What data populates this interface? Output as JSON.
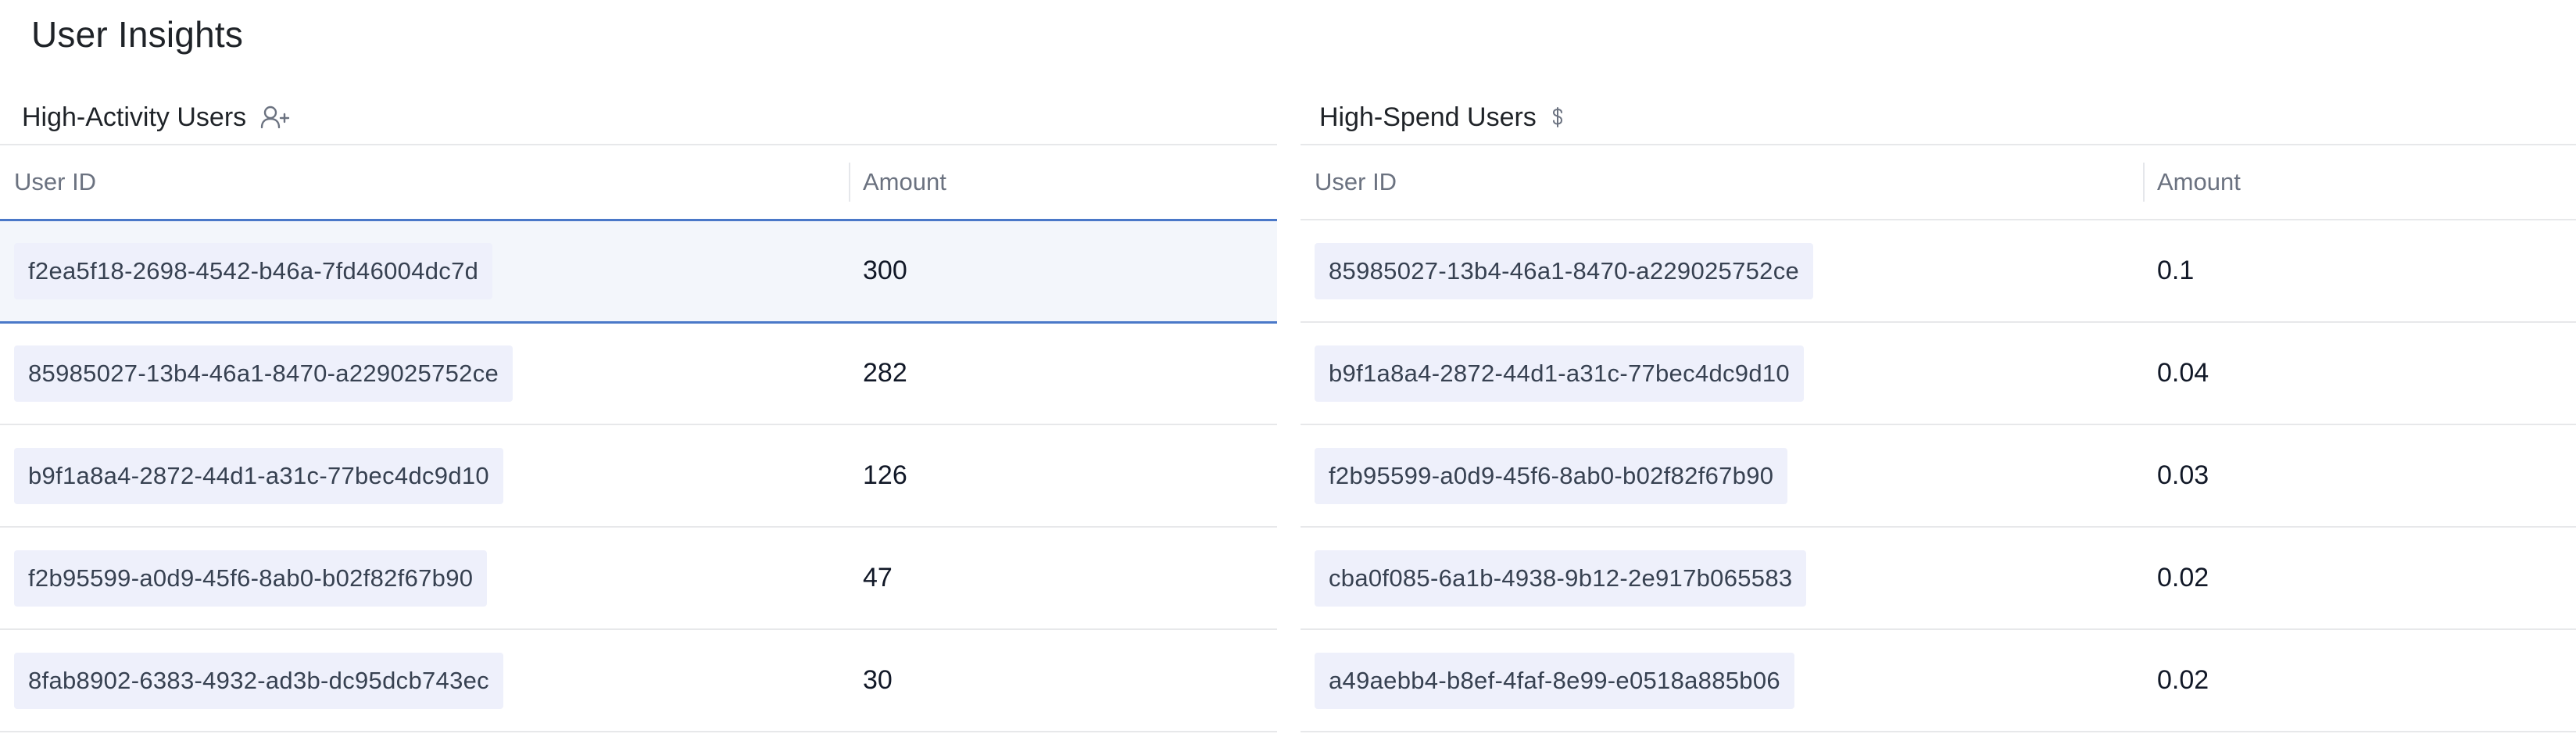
{
  "page": {
    "title": "User Insights"
  },
  "high_activity": {
    "title": "High-Activity Users",
    "icon": "user-plus-icon",
    "columns": {
      "user_id": "User ID",
      "amount": "Amount"
    },
    "rows": [
      {
        "user_id": "f2ea5f18-2698-4542-b46a-7fd46004dc7d",
        "amount": "300"
      },
      {
        "user_id": "85985027-13b4-46a1-8470-a229025752ce",
        "amount": "282"
      },
      {
        "user_id": "b9f1a8a4-2872-44d1-a31c-77bec4dc9d10",
        "amount": "126"
      },
      {
        "user_id": "f2b95599-a0d9-45f6-8ab0-b02f82f67b90",
        "amount": "47"
      },
      {
        "user_id": "8fab8902-6383-4932-ad3b-dc95dcb743ec",
        "amount": "30"
      }
    ]
  },
  "high_spend": {
    "title": "High-Spend Users",
    "icon": "dollar-icon",
    "columns": {
      "user_id": "User ID",
      "amount": "Amount"
    },
    "rows": [
      {
        "user_id": "85985027-13b4-46a1-8470-a229025752ce",
        "amount": "0.1"
      },
      {
        "user_id": "b9f1a8a4-2872-44d1-a31c-77bec4dc9d10",
        "amount": "0.04"
      },
      {
        "user_id": "f2b95599-a0d9-45f6-8ab0-b02f82f67b90",
        "amount": "0.03"
      },
      {
        "user_id": "cba0f085-6a1b-4938-9b12-2e917b065583",
        "amount": "0.02"
      },
      {
        "user_id": "a49aebb4-b8ef-4faf-8e99-e0518a885b06",
        "amount": "0.02"
      }
    ]
  },
  "colors": {
    "accent_selected_border": "#4a78c8",
    "chip_background": "#eef0fb",
    "divider": "#e7e8ea"
  }
}
